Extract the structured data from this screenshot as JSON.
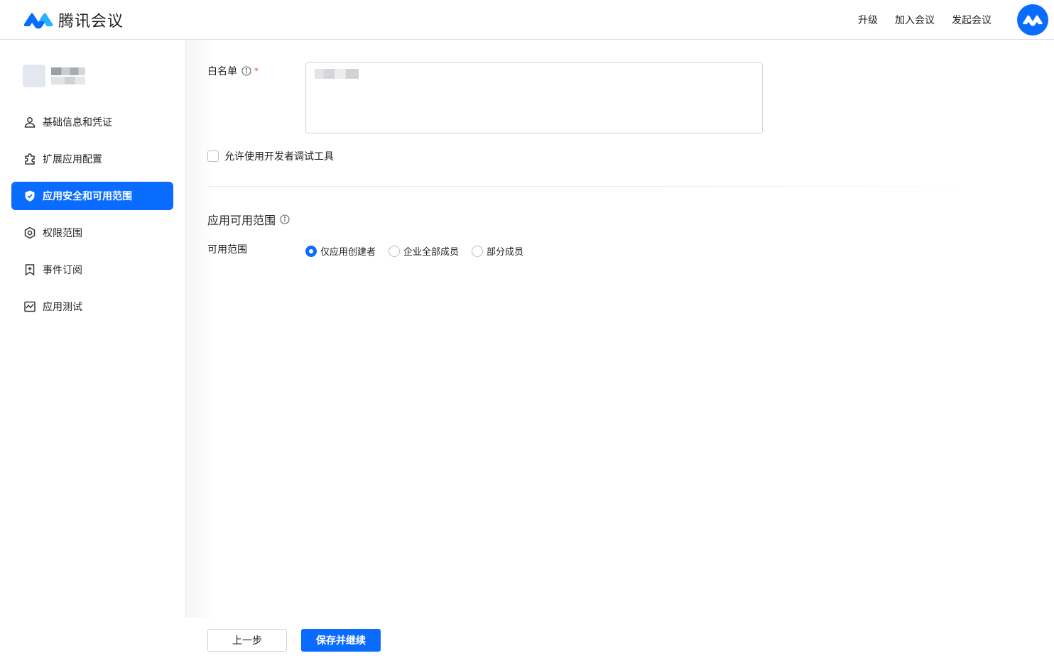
{
  "header": {
    "brand": "腾讯会议",
    "nav": [
      "升级",
      "加入会议",
      "发起会议"
    ],
    "brand_color": "#0a6cff"
  },
  "sidebar": {
    "items": [
      {
        "label": "基础信息和凭证",
        "icon": "user-icon",
        "active": false
      },
      {
        "label": "扩展应用配置",
        "icon": "puzzle-icon",
        "active": false
      },
      {
        "label": "应用安全和可用范围",
        "icon": "shield-icon",
        "active": true
      },
      {
        "label": "权限范围",
        "icon": "gear-icon",
        "active": false
      },
      {
        "label": "事件订阅",
        "icon": "bookmark-plus-icon",
        "active": false
      },
      {
        "label": "应用测试",
        "icon": "chart-icon",
        "active": false
      }
    ]
  },
  "form": {
    "whitelist_label": "白名单",
    "required_mark": "*",
    "devtools_label": "允许使用开发者调试工具",
    "devtools_checked": false,
    "scope_section_title": "应用可用范围",
    "scope_label": "可用范围",
    "scope_options": [
      "仅应用创建者",
      "企业全部成员",
      "部分成员"
    ],
    "scope_selected": "仅应用创建者"
  },
  "footer": {
    "prev_label": "上一步",
    "save_label": "保存并继续"
  }
}
